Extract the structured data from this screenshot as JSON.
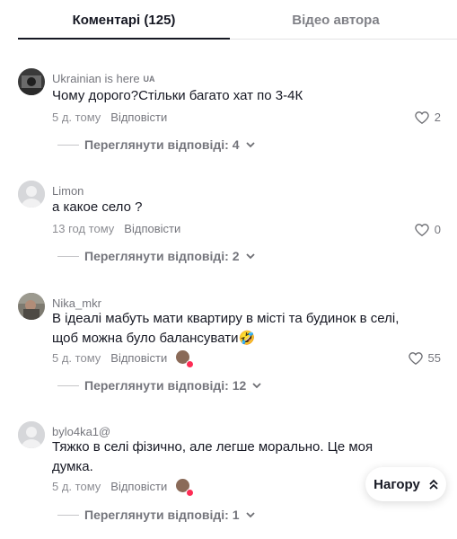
{
  "tabs": [
    {
      "label": "Коментарі (125)",
      "active": true
    },
    {
      "label": "Відео автора",
      "active": false
    }
  ],
  "comments": [
    {
      "username": "Ukrainian is here",
      "flag": "UA",
      "text": "Чому дорого?Стільки багато хат по 3-4К",
      "time": "5 д. тому",
      "reply_label": "Відповісти",
      "likes": "2",
      "view_replies": "Переглянути відповіді: 4",
      "avatar": "dark-photo"
    },
    {
      "username": "Limon",
      "text": "а какое село ?",
      "time": "13 год тому",
      "reply_label": "Відповісти",
      "likes": "0",
      "view_replies": "Переглянути відповіді: 2",
      "avatar": "default-grey"
    },
    {
      "username": "Nika_mkr",
      "text_line1": "В ідеалі мабуть мати квартиру в місті та будинок в селі,",
      "text_line2": "щоб можна було балансувати",
      "emoji": "🤣",
      "time": "5 д. тому",
      "reply_label": "Відповісти",
      "likes": "55",
      "view_replies": "Переглянути відповіді: 12",
      "avatar": "photo"
    },
    {
      "username": "bylo4ka1@",
      "text_line1": "Тяжко в селі фізично, але легше морально. Це моя",
      "text_line2": "думка.",
      "time": "5 д. тому",
      "reply_label": "Відповісти",
      "view_replies": "Переглянути відповіді: 1",
      "avatar": "default-grey"
    }
  ],
  "back_to_top": "Нагору",
  "colors": {
    "primary_text": "#161823",
    "secondary_text": "#8a8b91",
    "accent": "#fe2c55"
  }
}
